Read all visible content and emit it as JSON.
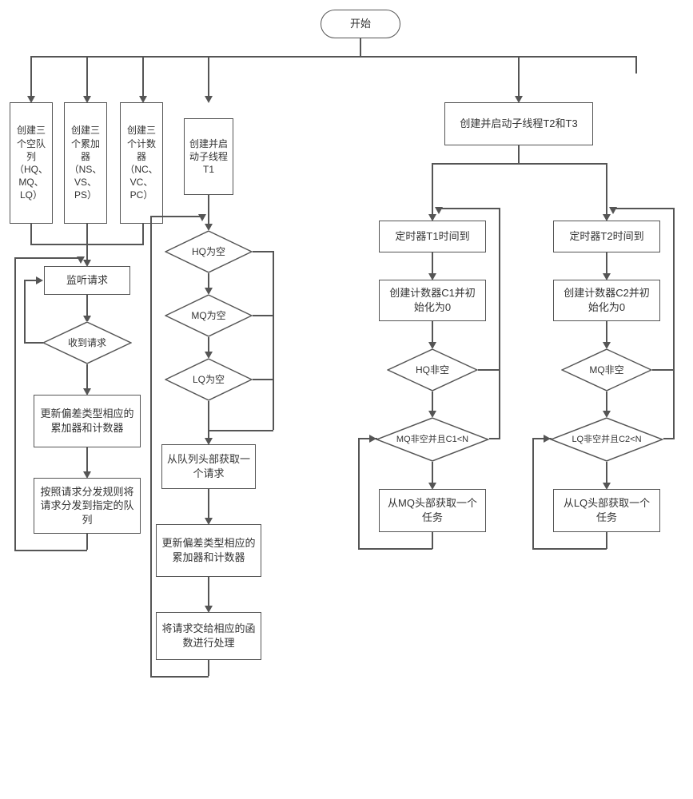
{
  "start": "开始",
  "leftBranch": {
    "queues": "创建三个空队列（HQ、MQ、LQ）",
    "accumulators": "创建三个累加器（NS、VS、PS）",
    "counters": "创建三个计数器（NC、VC、PC）",
    "listen": "监听请求",
    "receive": "收到请求",
    "updateAccCnt": "更新偏差类型相应的累加器和计数器",
    "dispatch": "按照请求分发规则将请求分发到指定的队列"
  },
  "t1Branch": {
    "createT1": "创建并启动子线程T1",
    "hqEmpty": "HQ为空",
    "mqEmpty": "MQ为空",
    "lqEmpty": "LQ为空",
    "getFromHead": "从队列头部获取一个请求",
    "updateAccCnt": "更新偏差类型相应的累加器和计数器",
    "handOff": "将请求交给相应的函数进行处理"
  },
  "rightBranch": {
    "createT2T3": "创建并启动子线程T2和T3",
    "t2_timer": "定时器T1时间到",
    "t2_counter": "创建计数器C1并初始化为0",
    "t2_hqNonEmpty": "HQ非空",
    "t2_mqCond": "MQ非空并且C1<N",
    "t2_fetchMQ": "从MQ头部获取一个任务",
    "t3_timer": "定时器T2时间到",
    "t3_counter": "创建计数器C2并初始化为0",
    "t3_mqNonEmpty": "MQ非空",
    "t3_lqCond": "LQ非空并且C2<N",
    "t3_fetchLQ": "从LQ头部获取一个任务"
  }
}
